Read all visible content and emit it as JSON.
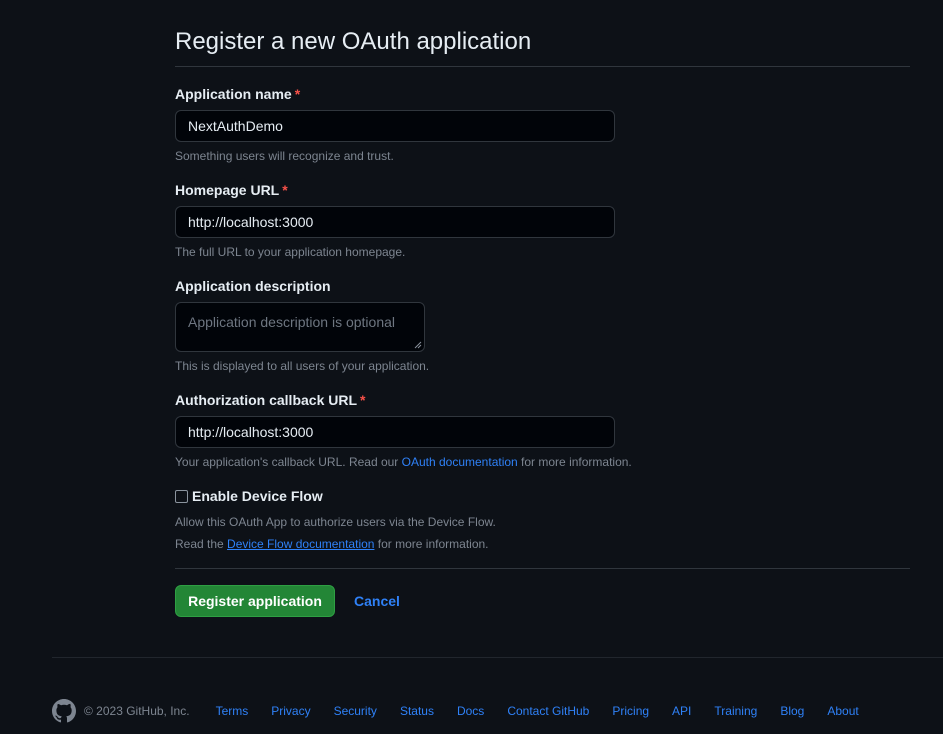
{
  "title": "Register a new OAuth application",
  "fields": {
    "app_name": {
      "label": "Application name",
      "required_mark": "*",
      "value": "NextAuthDemo",
      "note": "Something users will recognize and trust."
    },
    "homepage_url": {
      "label": "Homepage URL",
      "required_mark": "*",
      "value": "http://localhost:3000",
      "note": "The full URL to your application homepage."
    },
    "description": {
      "label": "Application description",
      "placeholder": "Application description is optional",
      "note": "This is displayed to all users of your application."
    },
    "callback_url": {
      "label": "Authorization callback URL",
      "required_mark": "*",
      "value": "http://localhost:3000",
      "note_before": "Your application's callback URL. Read our ",
      "note_link": "OAuth documentation",
      "note_after": " for more information."
    }
  },
  "device_flow": {
    "label": "Enable Device Flow",
    "checked": false,
    "note_line1": "Allow this OAuth App to authorize users via the Device Flow.",
    "note_line2_before": "Read the ",
    "note_line2_link": "Device Flow documentation",
    "note_line2_after": " for more information."
  },
  "actions": {
    "register_label": "Register application",
    "cancel_label": "Cancel"
  },
  "footer": {
    "copyright": "© 2023 GitHub, Inc.",
    "links": [
      "Terms",
      "Privacy",
      "Security",
      "Status",
      "Docs",
      "Contact GitHub",
      "Pricing",
      "API",
      "Training",
      "Blog",
      "About"
    ]
  },
  "colors": {
    "background": "#0d1117",
    "input_bg": "#010409",
    "border": "#30363d",
    "link": "#2f81f7",
    "required": "#f85149",
    "primary_button": "#238636",
    "muted_text": "#7d8590"
  }
}
